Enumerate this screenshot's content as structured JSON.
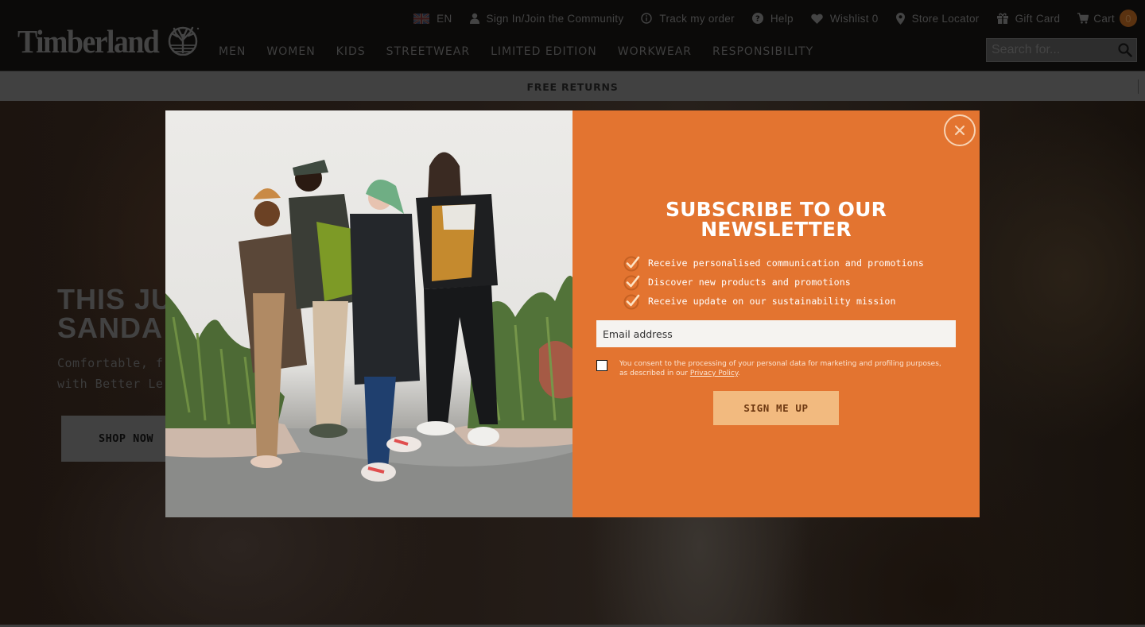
{
  "header": {
    "brand": "Timberland",
    "utility": {
      "language": "EN",
      "sign_in": "Sign In/Join the Community",
      "track_order": "Track my order",
      "help": "Help",
      "wishlist": "Wishlist 0",
      "store_locator": "Store Locator",
      "gift_card": "Gift Card",
      "cart": "Cart",
      "cart_count": "0"
    },
    "nav": [
      {
        "label": "MEN"
      },
      {
        "label": "WOMEN"
      },
      {
        "label": "KIDS"
      },
      {
        "label": "STREETWEAR"
      },
      {
        "label": "LIMITED EDITION"
      },
      {
        "label": "WORKWEAR"
      },
      {
        "label": "RESPONSIBILITY"
      }
    ],
    "search": {
      "placeholder": "Search for..."
    }
  },
  "promo_bar": {
    "text": "FREE RETURNS"
  },
  "hero": {
    "title": "THIS JU\nSANDA",
    "subtitle": "Comfortable, f\nwith Better Le",
    "cta": "SHOP NOW"
  },
  "modal": {
    "image_alt": "Four models wearing Timberland streetwear jackets and sneakers",
    "title": "SUBSCRIBE TO OUR\nNEWSLETTER",
    "benefits": [
      "Receive personalised communication and promotions",
      "Discover new products and promotions",
      "Receive update on our sustainability mission"
    ],
    "email_placeholder": "Email address",
    "consent_text": "You consent to the processing of your personal data for marketing and profiling purposes, as described in our ",
    "privacy_link": "Privacy Policy",
    "consent_end": ".",
    "consent_checked": false,
    "submit": "SIGN ME UP"
  },
  "colors": {
    "modal_panel": "#e37430",
    "submit_bg": "#f2ba7f",
    "submit_text": "#6e3912",
    "cart_badge": "#5a3210"
  }
}
